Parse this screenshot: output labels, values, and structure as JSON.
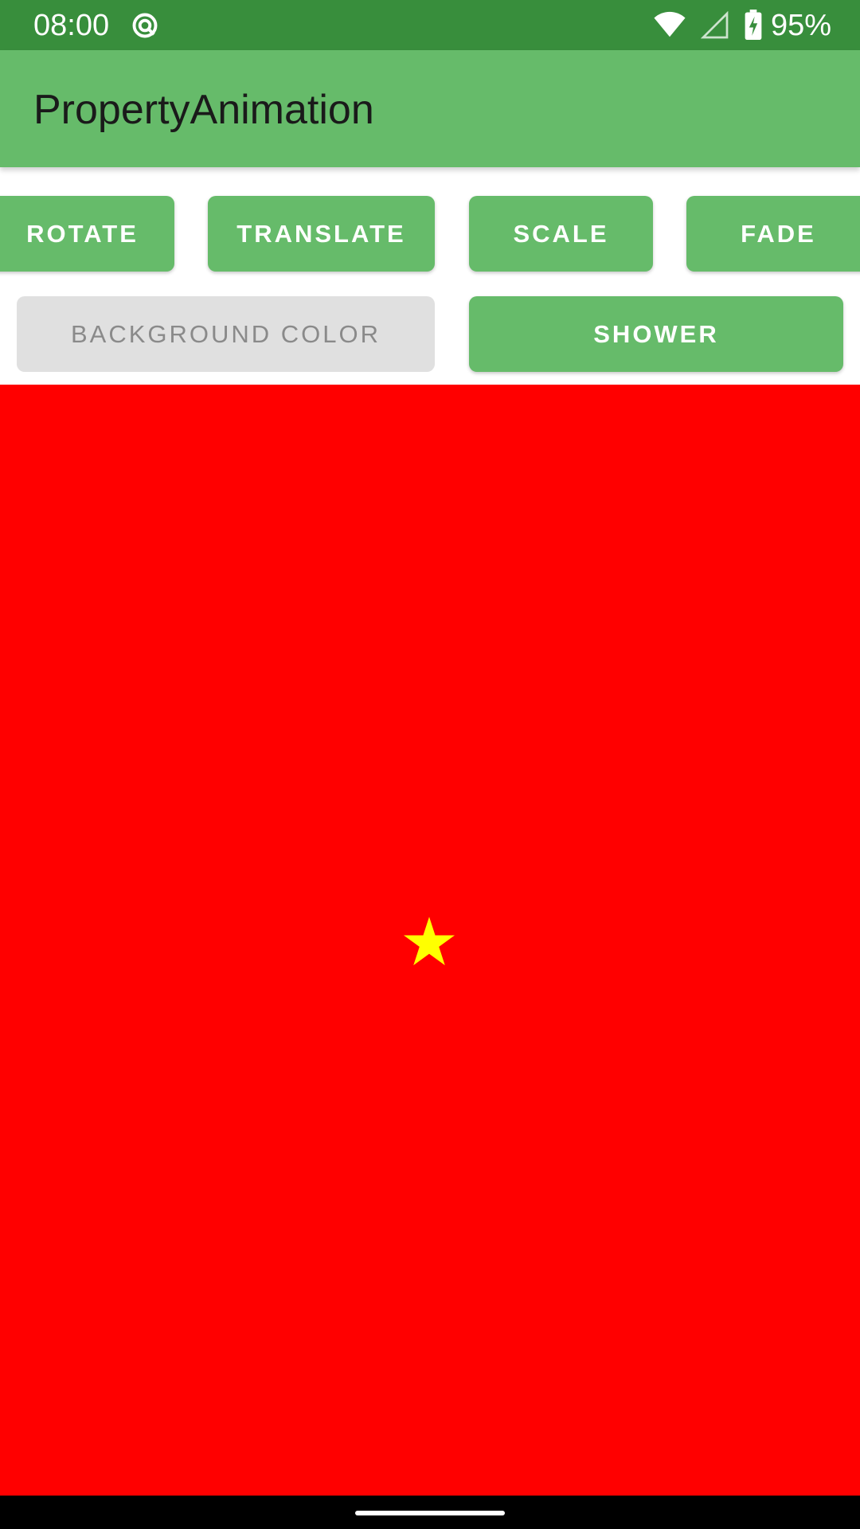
{
  "status_bar": {
    "time": "08:00",
    "battery": "95%",
    "icons": [
      "sync-icon",
      "wifi-icon",
      "signal-icon",
      "battery-charging-icon"
    ]
  },
  "app_bar": {
    "title": "PropertyAnimation"
  },
  "buttons": {
    "rotate": "ROTATE",
    "translate": "TRANSLATE",
    "scale": "SCALE",
    "fade": "FADE",
    "background_color": "BACKGROUND COLOR",
    "shower": "SHOWER"
  },
  "canvas": {
    "background_color": "#FF0000",
    "star_color": "#FFFF00",
    "star_icon": "star-icon"
  },
  "colors": {
    "status_bar": "#388E3C",
    "primary": "#66BB6A",
    "disabled_button": "#E0E0E0"
  }
}
